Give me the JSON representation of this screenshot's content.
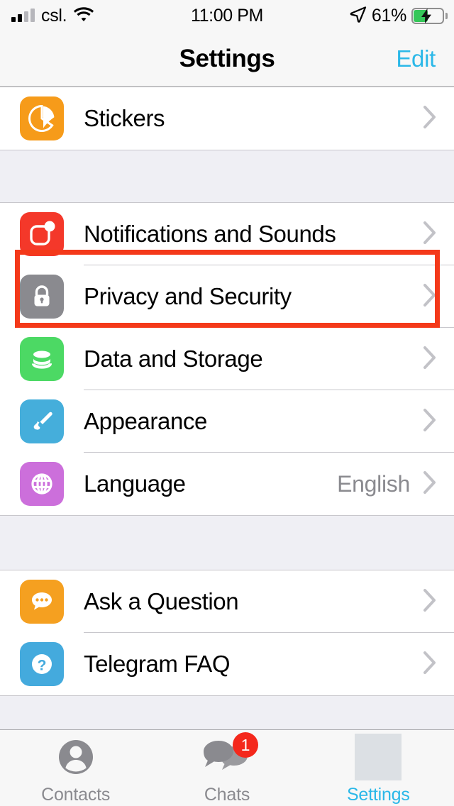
{
  "status_bar": {
    "carrier": "csl.",
    "time": "11:00 PM",
    "battery_percent": "61%",
    "signal_bars_filled": 2,
    "signal_bars_total": 4,
    "wifi_icon": "wifi-icon",
    "location_icon": "location-arrow-icon",
    "battery_icon": "battery-charging-icon"
  },
  "navbar": {
    "title": "Settings",
    "edit_label": "Edit"
  },
  "colors": {
    "accent": "#2BB8E8",
    "highlight_box": "#F4391A",
    "badge_red": "#F4281C",
    "group_background": "#FFFFFF",
    "page_background": "#EFEFF4",
    "separator": "#C8C7CC",
    "value_text": "#8A8A8F"
  },
  "sections": [
    {
      "name": "stickers-section",
      "rows": [
        {
          "label": "Stickers",
          "value": "",
          "icon": "stickers-icon",
          "icon_color": "#F69B1A",
          "chevron": true,
          "highlighted": false
        }
      ]
    },
    {
      "name": "preferences-section",
      "rows": [
        {
          "label": "Notifications and Sounds",
          "value": "",
          "icon": "notifications-icon",
          "icon_color": "#F4382A",
          "chevron": true,
          "highlighted": false
        },
        {
          "label": "Privacy and Security",
          "value": "",
          "icon": "lock-icon",
          "icon_color": "#8A8A8F",
          "chevron": true,
          "highlighted": true
        },
        {
          "label": "Data and Storage",
          "value": "",
          "icon": "database-icon",
          "icon_color": "#4CD964",
          "chevron": true,
          "highlighted": false
        },
        {
          "label": "Appearance",
          "value": "",
          "icon": "paintbrush-icon",
          "icon_color": "#45AEDB",
          "chevron": true,
          "highlighted": false
        },
        {
          "label": "Language",
          "value": "English",
          "icon": "globe-icon",
          "icon_color": "#CC6FDB",
          "chevron": true,
          "highlighted": false
        }
      ]
    },
    {
      "name": "help-section",
      "rows": [
        {
          "label": "Ask a Question",
          "value": "",
          "icon": "chat-bubble-icon",
          "icon_color": "#F5A020",
          "chevron": true,
          "highlighted": false
        },
        {
          "label": "Telegram FAQ",
          "value": "",
          "icon": "question-mark-icon",
          "icon_color": "#44AADD",
          "chevron": true,
          "highlighted": false
        }
      ]
    }
  ],
  "tabbar": {
    "tabs": [
      {
        "label": "Contacts",
        "icon": "contacts-person-icon",
        "active": false,
        "badge": ""
      },
      {
        "label": "Chats",
        "icon": "chats-bubbles-icon",
        "active": false,
        "badge": "1"
      },
      {
        "label": "Settings",
        "icon": "settings-placeholder-icon",
        "active": true,
        "badge": ""
      }
    ]
  }
}
